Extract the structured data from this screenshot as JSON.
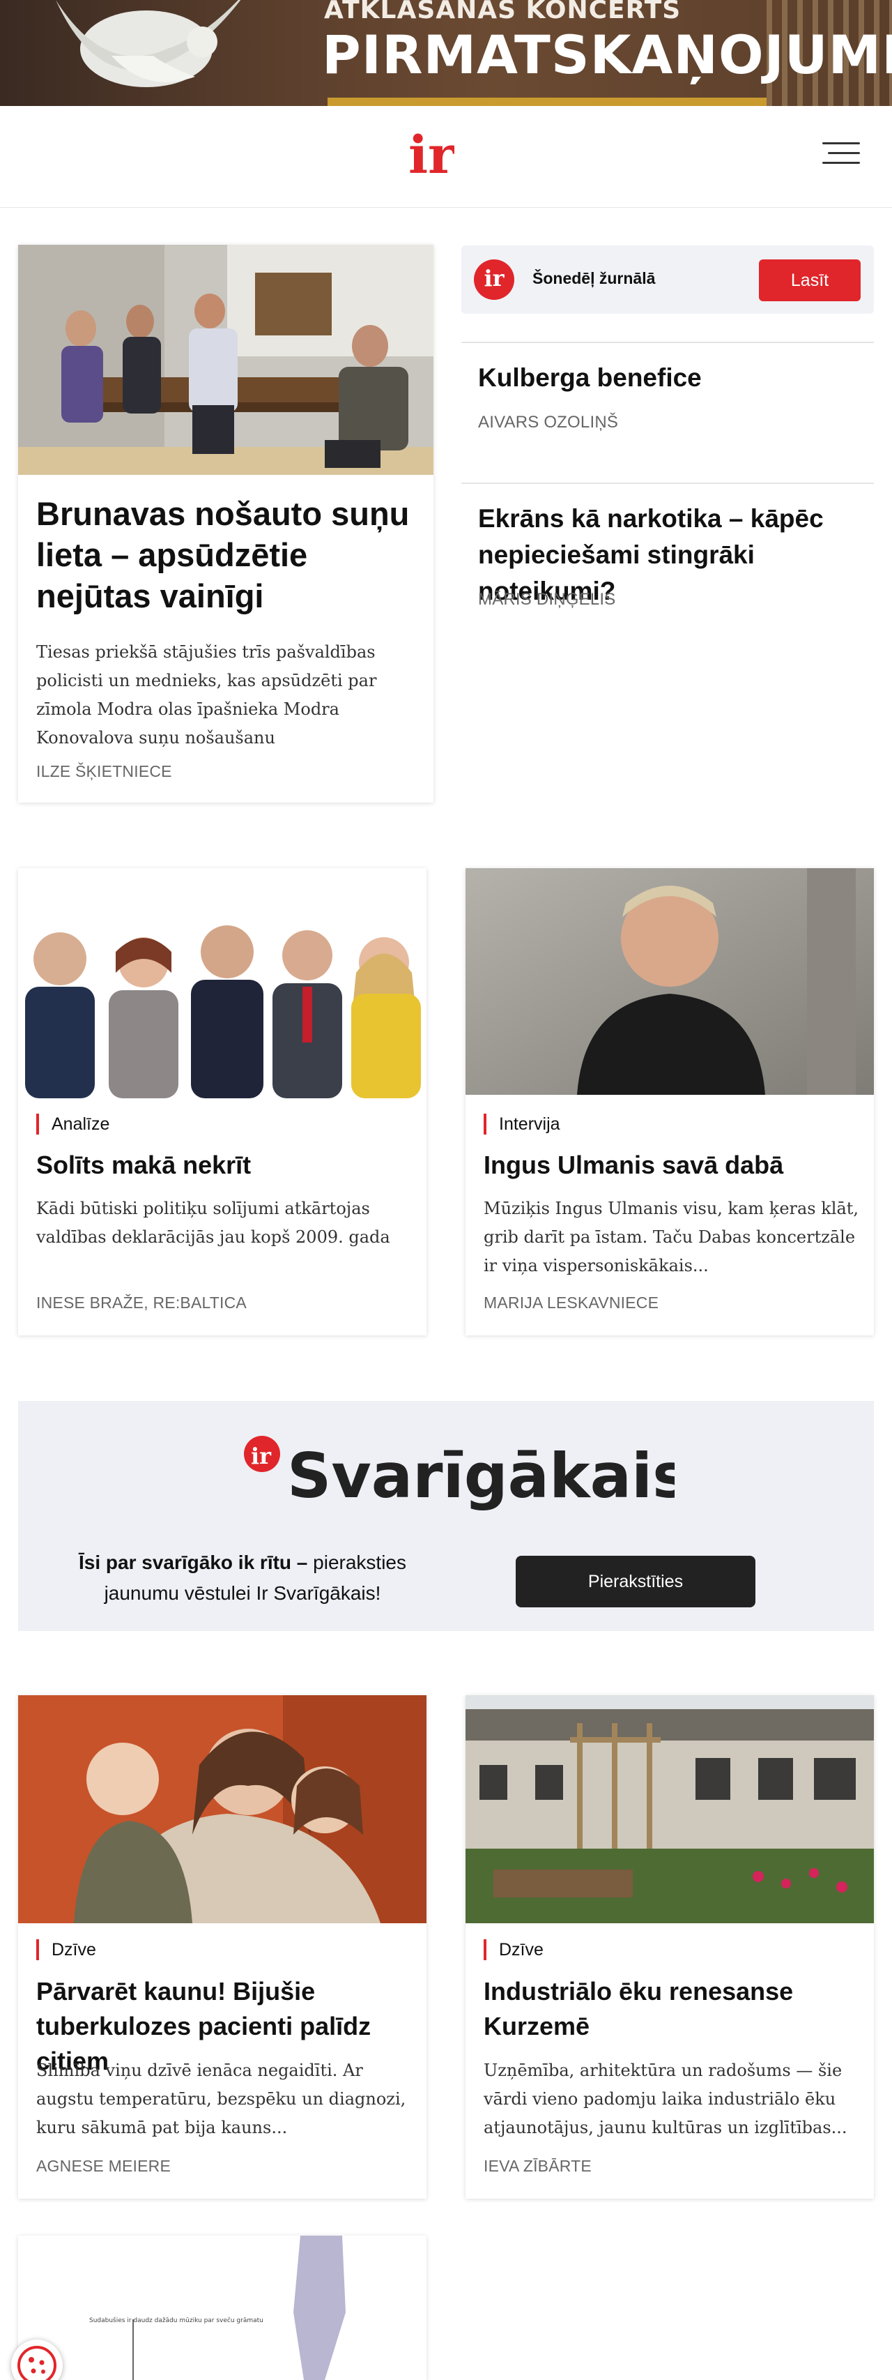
{
  "banner": {
    "pretitle": "ATKLĀŠANAS KONCERTS",
    "title": "PIRMATSKAŅOJUMI"
  },
  "header": {
    "logo_text": "ir",
    "menu_icon": "hamburger-menu-icon"
  },
  "journal": {
    "badge": "ir",
    "label": "Šonedēļ žurnālā",
    "button": "Lasīt"
  },
  "lead_article": {
    "headline": "Brunavas nošauto suņu lieta – apsūdzētie nejūtas vainīgi",
    "lead": "Tiesas priekšā stājušies trīs pašvaldības policisti un mednieks, kas apsūdzēti par zīmola Modra olas īpašnieka Modra Konovalova suņu nošaušanu",
    "author": "ILZE ŠĶIETNIECE"
  },
  "sidebar": [
    {
      "headline": "Kulberga benefice",
      "author": "AIVARS OZOLIŅŠ"
    },
    {
      "headline": "Ekrāns kā narkotika – kāpēc nepieciešami stingrāki noteikumi?",
      "author": "MĀRIS DIŅĢELIS"
    }
  ],
  "articles": [
    {
      "category": "Analīze",
      "headline": "Solīts makā nekrīt",
      "lead": "Kādi būtiski politiķu solījumi atkārtojas valdības deklarācijās jau kopš 2009. gada",
      "author": "INESE BRAŽE, RE:BALTICA"
    },
    {
      "category": "Intervija",
      "headline": "Ingus Ulmanis savā dabā",
      "lead": "Mūziķis Ingus Ulmanis visu, kam ķeras klāt, grib darīt pa īstam. Taču Dabas koncertzāle ir viņa vispersoniskākais...",
      "author": "MARIJA LESKAVNIECE"
    },
    {
      "category": "Dzīve",
      "headline": "Pārvarēt kaunu! Bijušie tuberkulozes pacienti palīdz citiem",
      "lead": "Slimība viņu dzīvē ienāca negaidīti. Ar augstu temperatūru, bezspēku un diagnozi, kuru sākumā pat bija kauns...",
      "author": "AGNESE MEIERE"
    },
    {
      "category": "Dzīve",
      "headline": "Industriālo ēku renesanse Kurzemē",
      "lead": "Uzņēmība, arhitektūra un radošums — šie vārdi vieno padomju laika industriālo ēku atjaunotājus, jaunu kultūras un izglītības...",
      "author": "IEVA ZĪBĀRTE"
    }
  ],
  "promo": {
    "logo_badge": "ir",
    "logo_text": "Svarīgākais",
    "text_bold": "Īsi par svarīgāko ik rītu –",
    "text_rest": " pieraksties jaunumu vēstulei Ir Svarīgākais!",
    "button": "Pierakstīties"
  },
  "bottom_card": {
    "caption": "Sudabušies ir daudz dažādu mūziku par sveču grāmatu"
  },
  "colors": {
    "accent": "#e0262b",
    "dark_button": "#222222",
    "promo_bg": "#eef0f5"
  }
}
